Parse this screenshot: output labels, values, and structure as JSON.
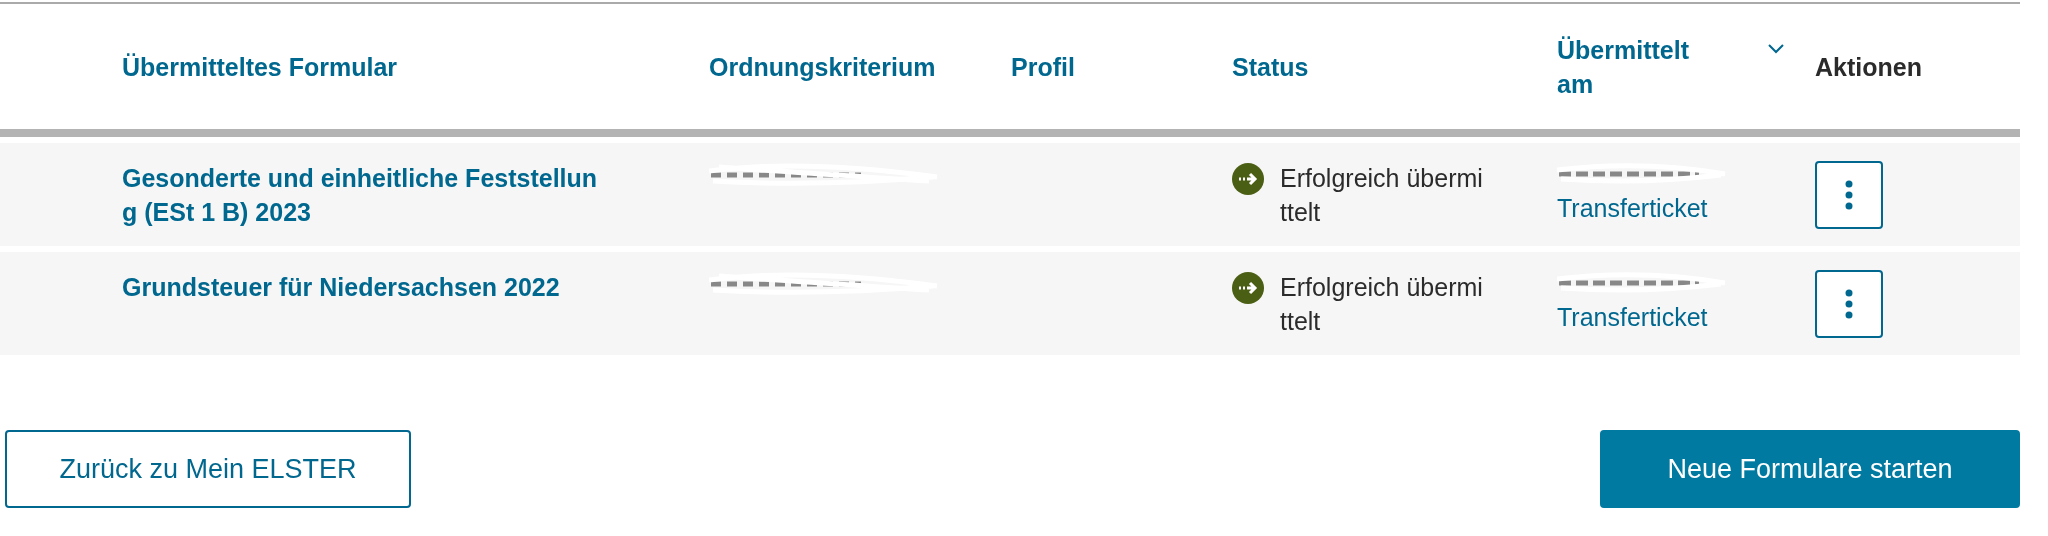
{
  "table": {
    "columns": [
      {
        "label": "Übermitteltes Formular",
        "sortable": true,
        "sorted": false
      },
      {
        "label": "Ordnungskriterium",
        "sortable": true,
        "sorted": false
      },
      {
        "label": "Profil",
        "sortable": true,
        "sorted": false
      },
      {
        "label": "Status",
        "sortable": true,
        "sorted": false
      },
      {
        "label": "Übermittelt am",
        "sortable": true,
        "sorted": true
      },
      {
        "label": "Aktionen",
        "sortable": false
      }
    ],
    "rows": [
      {
        "form": "Gesonderte und einheitliche Feststellung (ESt 1 B) 2023",
        "criterion_redacted": true,
        "date_redacted": true,
        "status": {
          "kind": "success",
          "text": "Erfolgreich übermittelt"
        },
        "link": "Transferticket"
      },
      {
        "form": "Grundsteuer für Niedersachsen 2022",
        "criterion_redacted": true,
        "date_redacted": true,
        "status": {
          "kind": "success",
          "text": "Erfolgreich übermittelt"
        },
        "link": "Transferticket"
      }
    ]
  },
  "buttons": [
    {
      "label": "Zurück zu Mein ELSTER",
      "kind": "secondary"
    },
    {
      "label": "Neue Formulare starten",
      "kind": "primary"
    }
  ]
}
